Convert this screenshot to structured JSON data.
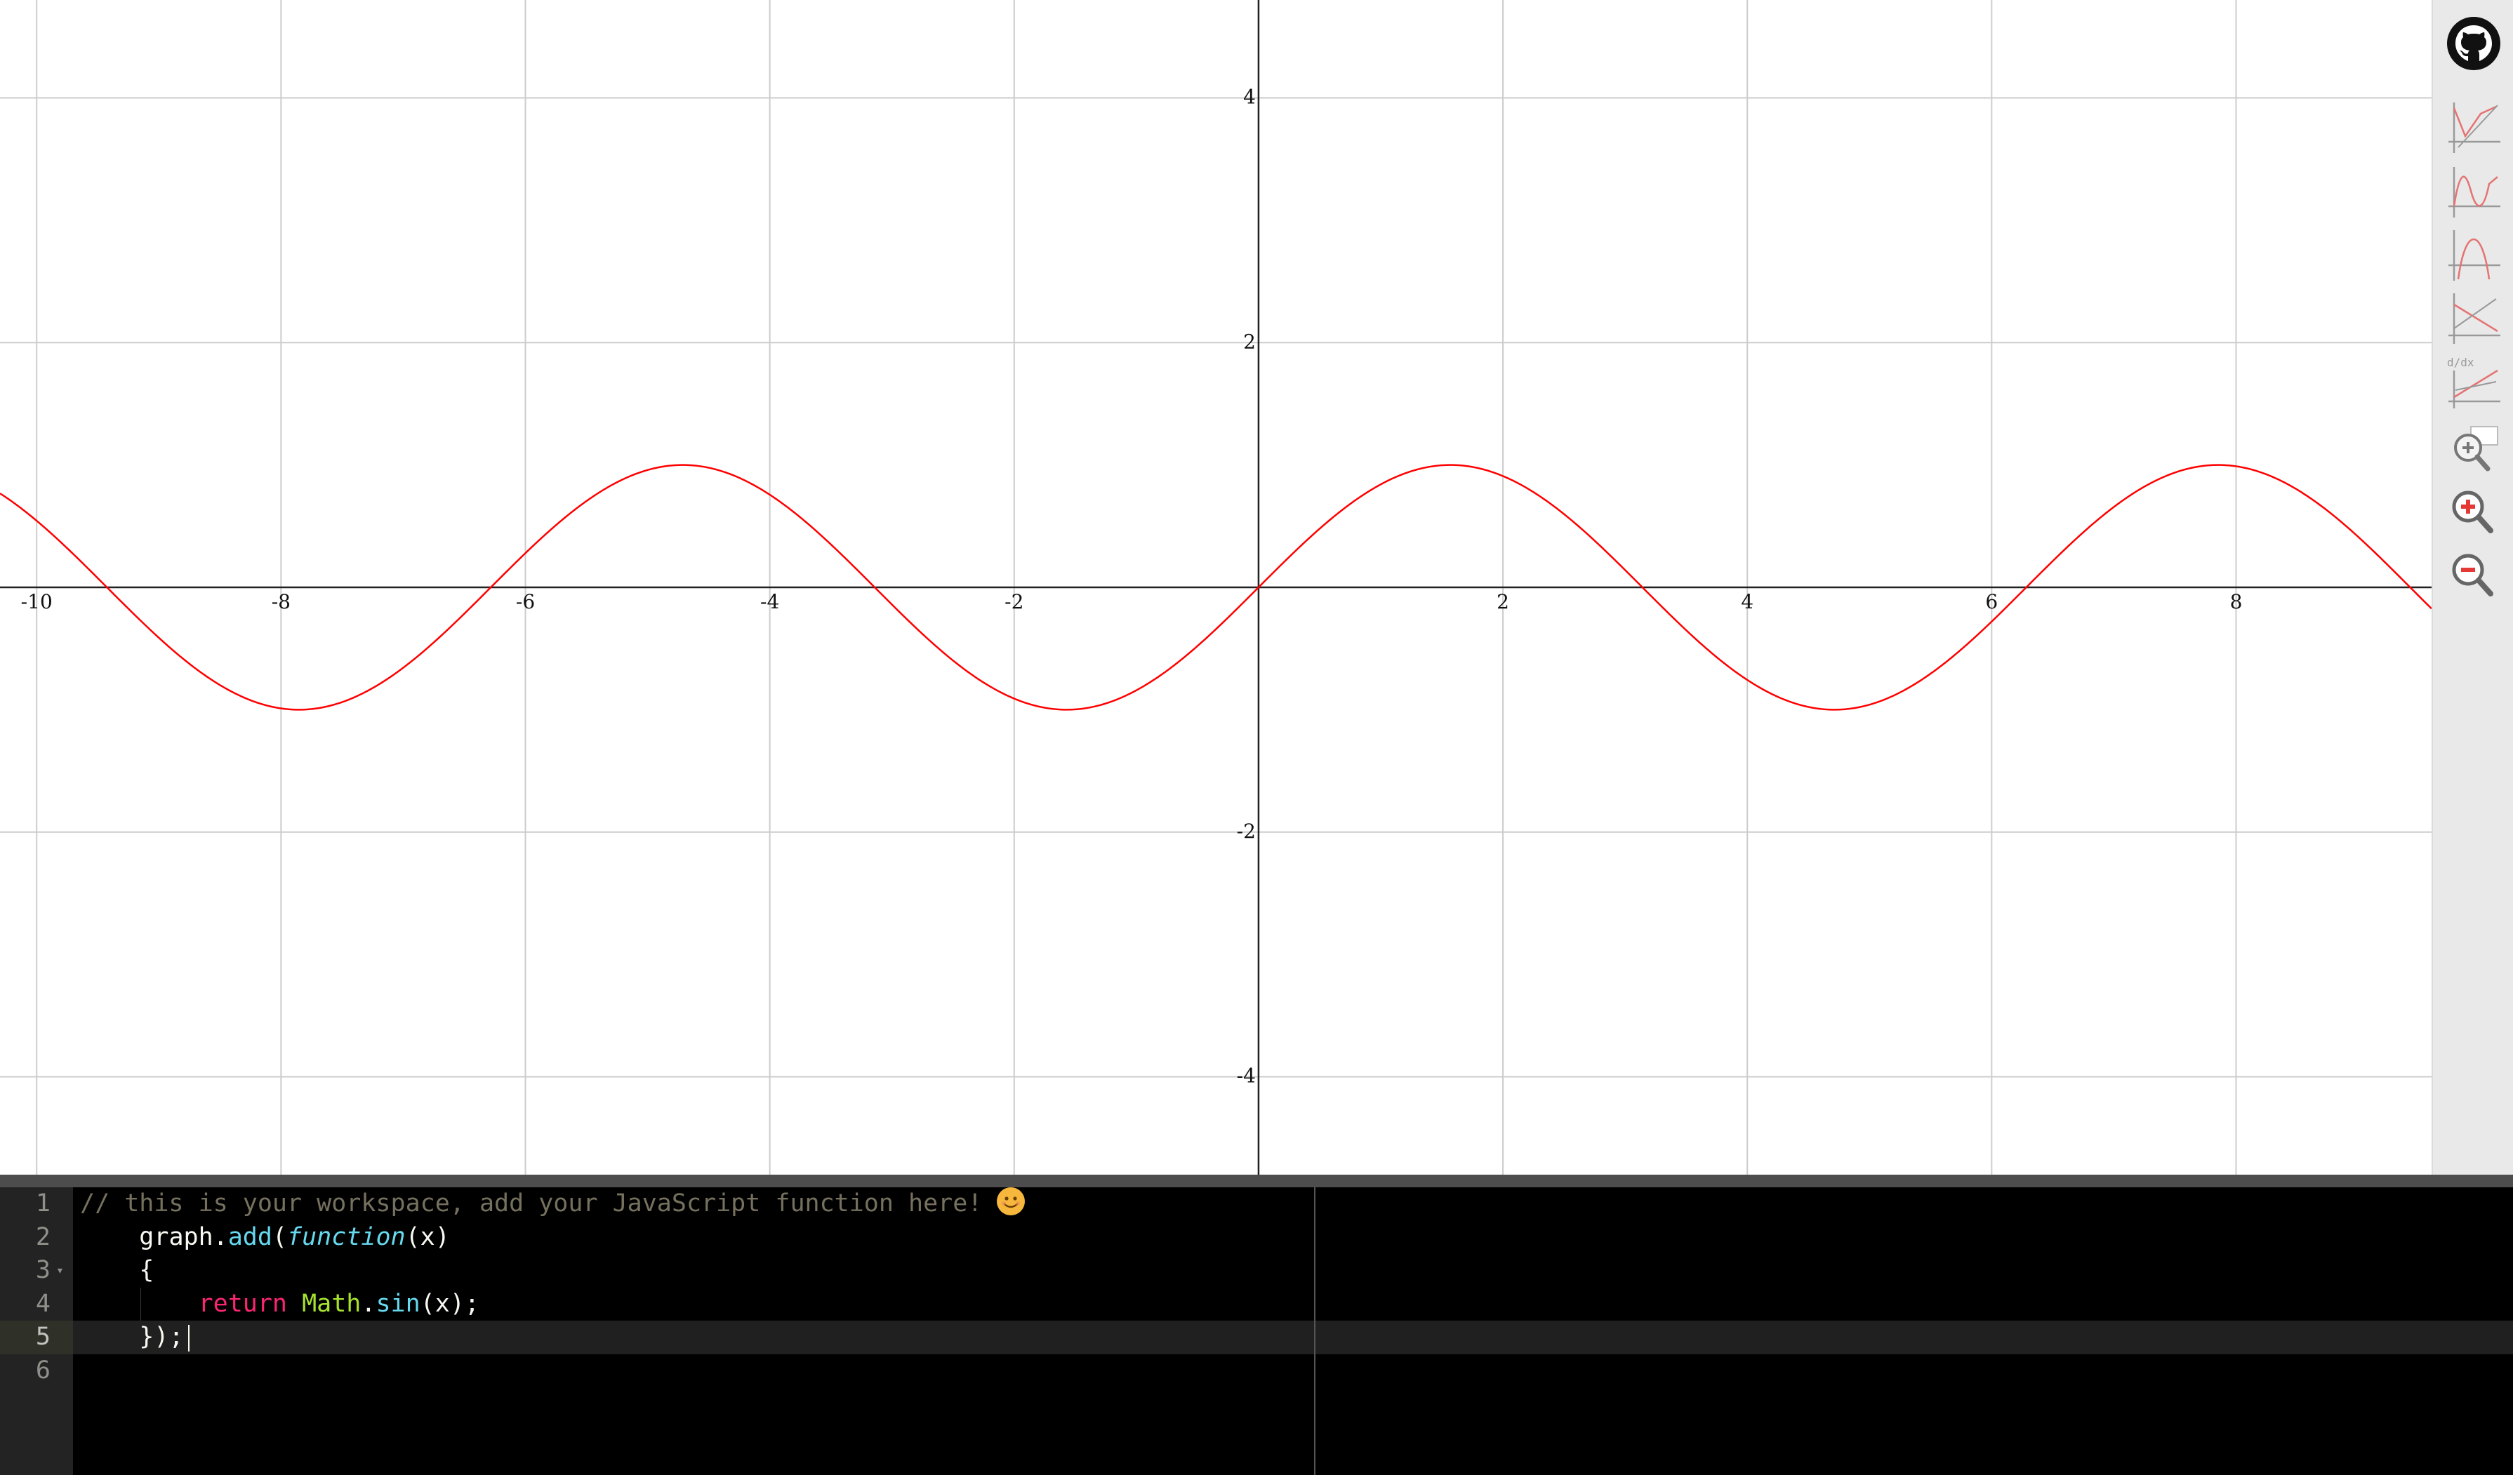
{
  "graph": {
    "function_expression": "Math.sin(x)",
    "curve_color": "#ff0000",
    "x_range": [
      -10.3,
      9.6
    ],
    "y_range": [
      -4.8,
      4.8
    ],
    "x_ticks": [
      "-10",
      "-8",
      "-6",
      "-4",
      "-2",
      "2",
      "4",
      "6",
      "8"
    ],
    "y_ticks": [
      "4",
      "2",
      "-2",
      "-4"
    ],
    "grid": true
  },
  "chart_data": {
    "type": "line",
    "title": "",
    "xlabel": "",
    "ylabel": "",
    "xlim": [
      -10.3,
      9.6
    ],
    "ylim": [
      -4.8,
      4.8
    ],
    "grid": true,
    "series": [
      {
        "function": "sin(x)",
        "color": "#ff0000"
      }
    ]
  },
  "sidebar": {
    "tools": [
      {
        "icon": "github-icon"
      },
      {
        "icon": "plot-linear-icon"
      },
      {
        "icon": "plot-wave-icon"
      },
      {
        "icon": "plot-parabola-icon"
      },
      {
        "icon": "plot-cross-icon"
      },
      {
        "icon": "derivative-icon",
        "label": "d/dx"
      },
      {
        "icon": "zoom-fit-icon"
      },
      {
        "icon": "zoom-in-icon"
      },
      {
        "icon": "zoom-out-icon"
      }
    ]
  },
  "editor": {
    "line_numbers": [
      "1",
      "2",
      "3",
      "4",
      "5",
      "6"
    ],
    "active_line": "5",
    "lines": {
      "l1_comment": "// this is your workspace, add your JavaScript function here! ",
      "l1_emoji": "smiling-face-emoji",
      "l2_obj": "graph.",
      "l2_method": "add",
      "l2_paren_open": "(",
      "l2_function_kw": "function",
      "l2_args": "(x)",
      "l3": "{",
      "l4_return": "return",
      "l4_math": "Math",
      "l4_dot": ".",
      "l4_sin": "sin",
      "l4_tail": "(x);",
      "l5": "});",
      "l6": ""
    }
  }
}
